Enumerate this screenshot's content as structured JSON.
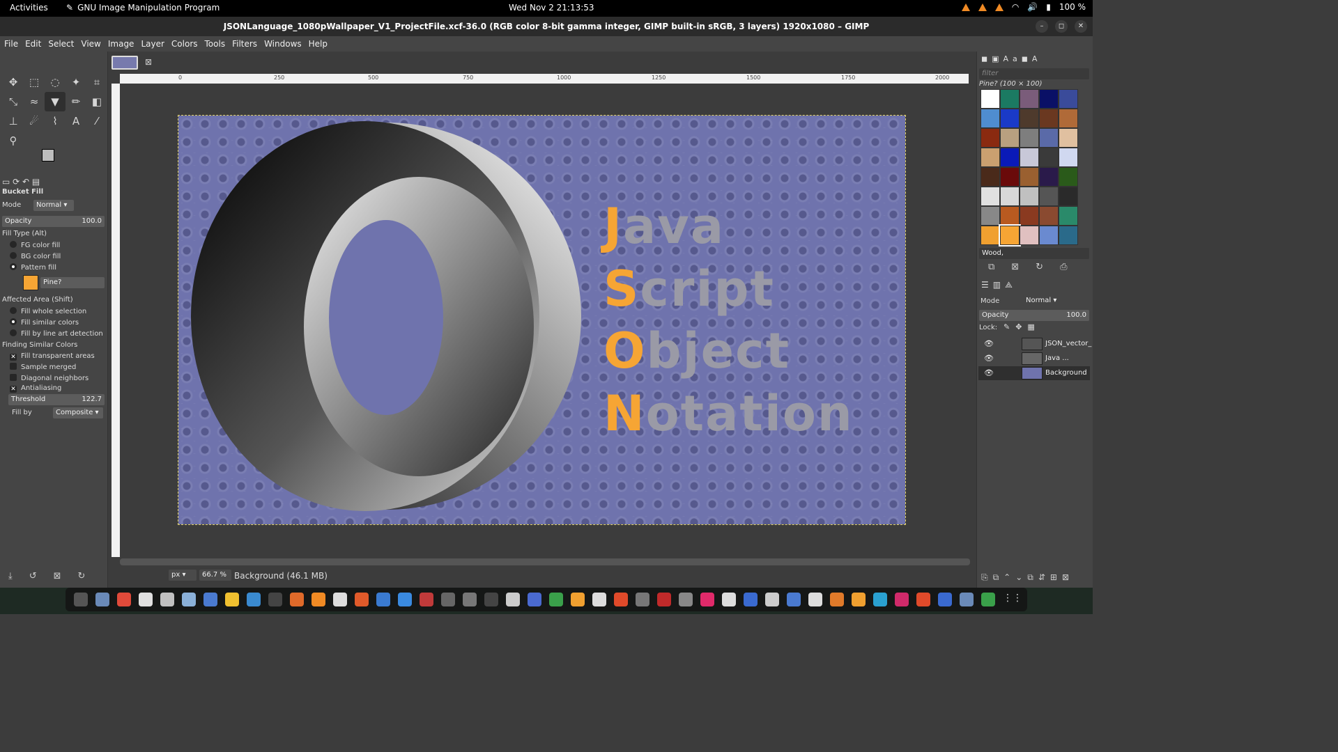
{
  "topbar": {
    "activities": "Activities",
    "app_name": "GNU Image Manipulation Program",
    "clock": "Wed Nov 2  21:13:53",
    "battery": "100 %"
  },
  "window": {
    "title": "JSONLanguage_1080pWallpaper_V1_ProjectFile.xcf-36.0 (RGB color 8-bit gamma integer, GIMP built-in sRGB, 3 layers) 1920x1080 – GIMP"
  },
  "menu": [
    "File",
    "Edit",
    "Select",
    "View",
    "Image",
    "Layer",
    "Colors",
    "Tools",
    "Filters",
    "Windows",
    "Help"
  ],
  "tool_options": {
    "title": "Bucket Fill",
    "mode_label": "Mode",
    "mode_value": "Normal",
    "opacity_label": "Opacity",
    "opacity_value": "100.0",
    "fill_type_label": "Fill Type  (Alt)",
    "fill_types": [
      "FG color fill",
      "BG color fill",
      "Pattern fill"
    ],
    "pattern_name": "Pine?",
    "affected_label": "Affected Area  (Shift)",
    "affected": [
      "Fill whole selection",
      "Fill similar colors",
      "Fill by line art detection"
    ],
    "finding_label": "Finding Similar Colors",
    "finding": [
      "Fill transparent areas",
      "Sample merged",
      "Diagonal neighbors",
      "Antialiasing"
    ],
    "threshold_label": "Threshold",
    "threshold_value": "122.7",
    "fillby_label": "Fill by",
    "fillby_value": "Composite"
  },
  "ruler_labels": [
    "0",
    "250",
    "500",
    "750",
    "1000",
    "1250",
    "1500",
    "1750",
    "2000"
  ],
  "image_text": {
    "line1_cap": "J",
    "line1_rest": "ava",
    "line2_cap": "S",
    "line2_rest": "cript",
    "line3_cap": "O",
    "line3_rest": "bject",
    "line4_cap": "N",
    "line4_rest": "otation"
  },
  "status": {
    "unit": "px",
    "zoom": "66.7 %",
    "info": "Background (46.1 MB)"
  },
  "patterns_panel": {
    "filter_placeholder": "filter",
    "current": "Pine? (100 × 100)",
    "tag": "Wood,"
  },
  "layers_panel": {
    "mode_label": "Mode",
    "mode_value": "Normal",
    "opacity_label": "Opacity",
    "opacity_value": "100.0",
    "lock_label": "Lock:",
    "layers": [
      "JSON_vector_",
      "Java ...",
      "Background"
    ]
  }
}
